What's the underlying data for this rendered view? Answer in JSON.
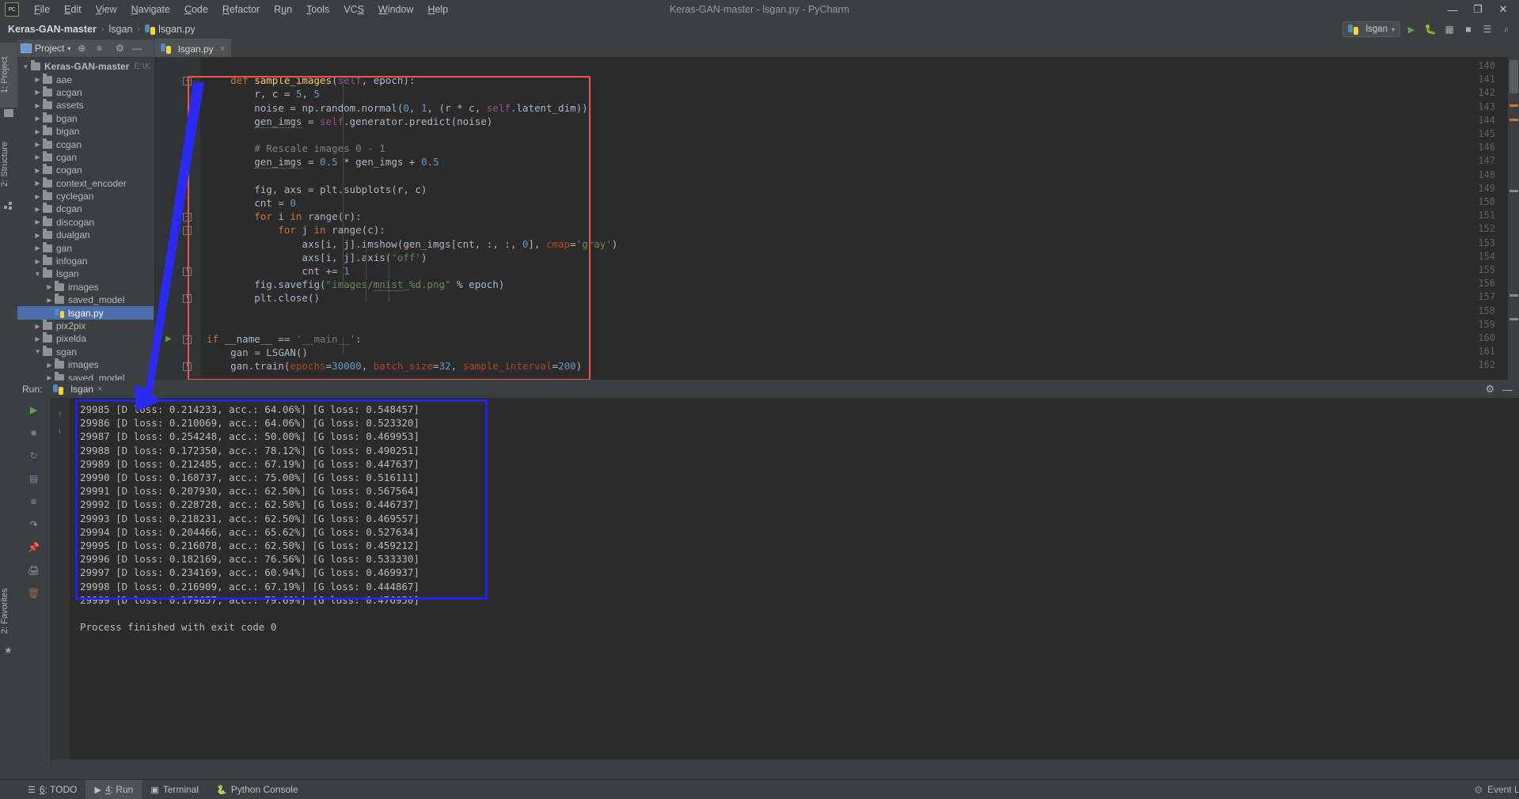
{
  "window": {
    "title": "Keras-GAN-master - lsgan.py - PyCharm",
    "minimize": "—",
    "maximize": "❐",
    "close": "✕"
  },
  "menu": [
    {
      "label": "File",
      "accel": "F"
    },
    {
      "label": "Edit",
      "accel": "E"
    },
    {
      "label": "View",
      "accel": "V"
    },
    {
      "label": "Navigate",
      "accel": "N"
    },
    {
      "label": "Code",
      "accel": "C"
    },
    {
      "label": "Refactor",
      "accel": "R"
    },
    {
      "label": "Run",
      "accel": "u"
    },
    {
      "label": "Tools",
      "accel": "T"
    },
    {
      "label": "VCS",
      "accel": "S"
    },
    {
      "label": "Window",
      "accel": "W"
    },
    {
      "label": "Help",
      "accel": "H"
    }
  ],
  "logo_text": "PC",
  "breadcrumb": {
    "root": "Keras-GAN-master",
    "folder": "lsgan",
    "file": "lsgan.py",
    "separator": "›"
  },
  "navbar_right": {
    "run_config": "lsgan",
    "run_icon": "▶",
    "debug_icon": "ὁe",
    "coverage_icon": "▣",
    "stop_icon": "■",
    "layout_icon": "☰",
    "search_icon": "⌕"
  },
  "left_tool_tabs": [
    {
      "label": "1: Project",
      "accel": "1",
      "active": true
    },
    {
      "label": "2: Structure",
      "accel": "2",
      "active": false
    }
  ],
  "bottom_left_tab": "2: Favorites",
  "project_panel": {
    "title": "Project",
    "dropdown_icon": "▾",
    "locate_icon": "⊕",
    "collapse_icon": "≡",
    "settings_icon": "⚙",
    "hide_icon": "—",
    "root_path": "E:\\K",
    "tree": [
      {
        "label": "Keras-GAN-master",
        "depth": 0,
        "type": "folder",
        "expanded": true,
        "bold": true,
        "selected": false
      },
      {
        "label": "aae",
        "depth": 1,
        "type": "folder",
        "expanded": false,
        "bold": false,
        "selected": false
      },
      {
        "label": "acgan",
        "depth": 1,
        "type": "folder",
        "expanded": false,
        "bold": false,
        "selected": false
      },
      {
        "label": "assets",
        "depth": 1,
        "type": "folder",
        "expanded": false,
        "bold": false,
        "selected": false
      },
      {
        "label": "bgan",
        "depth": 1,
        "type": "folder",
        "expanded": false,
        "bold": false,
        "selected": false
      },
      {
        "label": "bigan",
        "depth": 1,
        "type": "folder",
        "expanded": false,
        "bold": false,
        "selected": false
      },
      {
        "label": "ccgan",
        "depth": 1,
        "type": "folder",
        "expanded": false,
        "bold": false,
        "selected": false
      },
      {
        "label": "cgan",
        "depth": 1,
        "type": "folder",
        "expanded": false,
        "bold": false,
        "selected": false
      },
      {
        "label": "cogan",
        "depth": 1,
        "type": "folder",
        "expanded": false,
        "bold": false,
        "selected": false
      },
      {
        "label": "context_encoder",
        "depth": 1,
        "type": "folder",
        "expanded": false,
        "bold": false,
        "selected": false
      },
      {
        "label": "cyclegan",
        "depth": 1,
        "type": "folder",
        "expanded": false,
        "bold": false,
        "selected": false
      },
      {
        "label": "dcgan",
        "depth": 1,
        "type": "folder",
        "expanded": false,
        "bold": false,
        "selected": false
      },
      {
        "label": "discogan",
        "depth": 1,
        "type": "folder",
        "expanded": false,
        "bold": false,
        "selected": false
      },
      {
        "label": "dualgan",
        "depth": 1,
        "type": "folder",
        "expanded": false,
        "bold": false,
        "selected": false
      },
      {
        "label": "gan",
        "depth": 1,
        "type": "folder",
        "expanded": false,
        "bold": false,
        "selected": false
      },
      {
        "label": "infogan",
        "depth": 1,
        "type": "folder",
        "expanded": false,
        "bold": false,
        "selected": false
      },
      {
        "label": "lsgan",
        "depth": 1,
        "type": "folder",
        "expanded": true,
        "bold": false,
        "selected": false
      },
      {
        "label": "images",
        "depth": 2,
        "type": "folder",
        "expanded": false,
        "bold": false,
        "selected": false
      },
      {
        "label": "saved_model",
        "depth": 2,
        "type": "folder",
        "expanded": false,
        "bold": false,
        "selected": false
      },
      {
        "label": "lsgan.py",
        "depth": 2,
        "type": "python",
        "expanded": null,
        "bold": false,
        "selected": true
      },
      {
        "label": "pix2pix",
        "depth": 1,
        "type": "folder",
        "expanded": false,
        "bold": false,
        "selected": false
      },
      {
        "label": "pixelda",
        "depth": 1,
        "type": "folder",
        "expanded": false,
        "bold": false,
        "selected": false
      },
      {
        "label": "sgan",
        "depth": 1,
        "type": "folder",
        "expanded": true,
        "bold": false,
        "selected": false
      },
      {
        "label": "images",
        "depth": 2,
        "type": "folder",
        "expanded": false,
        "bold": false,
        "selected": false
      },
      {
        "label": "saved_model",
        "depth": 2,
        "type": "folder",
        "expanded": false,
        "bold": false,
        "selected": false
      }
    ]
  },
  "editor": {
    "tab_label": "lsgan.py",
    "close_icon": "×",
    "first_line_number": 140,
    "lines": [
      {
        "n": 140,
        "html": "",
        "fold": null
      },
      {
        "n": 141,
        "html": "    <span class='k'>def</span> <span class='def'>sample_images</span><span class='pl'>(</span><span class='self'>self</span><span class='pl'>, epoch):</span>",
        "fold": "minus"
      },
      {
        "n": 142,
        "html": "        <span class='pl'>r, c = </span><span class='num'>5</span><span class='pl'>, </span><span class='num'>5</span>",
        "fold": null
      },
      {
        "n": 143,
        "html": "        <span class='pl'>noise = np.random.normal(</span><span class='num'>0</span><span class='pl'>, </span><span class='num'>1</span><span class='pl'>, (r * c, </span><span class='self'>self</span><span class='pl'>.latent_dim))</span>",
        "fold": null
      },
      {
        "n": 144,
        "html": "        <span class='pl'><span class='wav'>gen_imgs</span> = </span><span class='self'>self</span><span class='pl'>.generator.predict(noise)</span>",
        "fold": null
      },
      {
        "n": 145,
        "html": "",
        "fold": null
      },
      {
        "n": 146,
        "html": "        <span class='cmt'># Rescale images 0 - 1</span>",
        "fold": null
      },
      {
        "n": 147,
        "html": "        <span class='pl'><span class='wav'>gen_imgs</span> = </span><span class='num'>0.5</span><span class='pl'> * gen_imgs + </span><span class='num'>0.5</span>",
        "fold": null
      },
      {
        "n": 148,
        "html": "",
        "fold": null
      },
      {
        "n": 149,
        "html": "        <span class='pl'>fig, axs = plt.subplots(r, c)</span>",
        "fold": null
      },
      {
        "n": 150,
        "html": "        <span class='pl'>cnt = </span><span class='num'>0</span>",
        "fold": null
      },
      {
        "n": 151,
        "html": "        <span class='k'>for</span><span class='pl'> i </span><span class='k'>in</span><span class='pl'> range(r):</span>",
        "fold": "minus"
      },
      {
        "n": 152,
        "html": "            <span class='k'>for</span><span class='pl'> j </span><span class='k'>in</span><span class='pl'> range(c):</span>",
        "fold": "minus"
      },
      {
        "n": 153,
        "html": "                <span class='pl'>axs[i, j].imshow(gen_imgs[cnt, :, :, </span><span class='num'>0</span><span class='pl'>], </span><span class='kw'>cmap</span><span class='pl'>=</span><span class='str'>'gray'</span><span class='pl'>)</span>",
        "fold": null
      },
      {
        "n": 154,
        "html": "                <span class='pl'>axs[i, j].axis(</span><span class='str'>'off'</span><span class='pl'>)</span>",
        "fold": null
      },
      {
        "n": 155,
        "html": "                <span class='pl'>cnt += </span><span class='num'>1</span>",
        "fold": "end"
      },
      {
        "n": 156,
        "html": "        <span class='pl'>fig.savefig(</span><span class='str'>\"images/<span class='wav'>mnist</span>_%d.png\"</span><span class='pl'> % epoch)</span>",
        "fold": null
      },
      {
        "n": 157,
        "html": "        <span class='pl'>plt.close()</span>",
        "fold": "end"
      },
      {
        "n": 158,
        "html": "",
        "fold": null
      },
      {
        "n": 159,
        "html": "",
        "fold": null
      },
      {
        "n": 160,
        "html": "<span class='k'>if</span><span class='pl'> __name__ == </span><span class='str'>'__main__'</span><span class='pl'>:</span>",
        "fold": "minus",
        "runnable": true
      },
      {
        "n": 161,
        "html": "    <span class='pl'>gan = LSGAN()</span>",
        "fold": null
      },
      {
        "n": 162,
        "html": "    <span class='pl'>gan.train(</span><span class='kw'>epochs</span><span class='pl'>=</span><span class='num'>30000</span><span class='pl'>, </span><span class='kw'>batch_size</span><span class='pl'>=</span><span class='num'>32</span><span class='pl'>, </span><span class='kw'>sample_interval</span><span class='pl'>=</span><span class='num'>200</span><span class='pl'>)</span>",
        "fold": "end"
      }
    ],
    "annotation_red_box": true
  },
  "run_window": {
    "label": "Run:",
    "tab_label": "lsgan",
    "tab_close": "×",
    "settings_icon": "⚙",
    "hide_icon": "—",
    "toolbar_icons": [
      "run-icon",
      "stop-icon",
      "rerun-icon",
      "scroll-up-icon",
      "scroll-down-icon",
      "print-icon",
      "soft-wrap-icon",
      "scroll-end-icon",
      "pin-icon",
      "close-icon",
      "trash-icon"
    ],
    "console_lines": [
      "29985 [D loss: 0.214233, acc.: 64.06%] [G loss: 0.548457]",
      "29986 [D loss: 0.210069, acc.: 64.06%] [G loss: 0.523320]",
      "29987 [D loss: 0.254248, acc.: 50.00%] [G loss: 0.469953]",
      "29988 [D loss: 0.172350, acc.: 78.12%] [G loss: 0.490251]",
      "29989 [D loss: 0.212485, acc.: 67.19%] [G loss: 0.447637]",
      "29990 [D loss: 0.168737, acc.: 75.00%] [G loss: 0.516111]",
      "29991 [D loss: 0.207930, acc.: 62.50%] [G loss: 0.567564]",
      "29992 [D loss: 0.228728, acc.: 62.50%] [G loss: 0.446737]",
      "29993 [D loss: 0.218231, acc.: 62.50%] [G loss: 0.469557]",
      "29994 [D loss: 0.204466, acc.: 65.62%] [G loss: 0.527634]",
      "29995 [D loss: 0.216078, acc.: 62.50%] [G loss: 0.459212]",
      "29996 [D loss: 0.182169, acc.: 76.56%] [G loss: 0.533330]",
      "29997 [D loss: 0.234169, acc.: 60.94%] [G loss: 0.469937]",
      "29998 [D loss: 0.216909, acc.: 67.19%] [G loss: 0.444867]",
      "29999 [D loss: 0.179657, acc.: 79.69%] [G loss: 0.476950]"
    ],
    "exit_message": "Process finished with exit code 0",
    "annotation_blue_box": true
  },
  "status_bar": {
    "items": [
      {
        "label": "6: TODO",
        "accel": "6",
        "icon": "todo-icon",
        "active": false
      },
      {
        "label": "4: Run",
        "accel": "4",
        "icon": "run-icon",
        "active": true
      },
      {
        "label": "Terminal",
        "accel": "",
        "icon": "terminal-icon",
        "active": false
      },
      {
        "label": "Python Console",
        "accel": "",
        "icon": "python-icon",
        "active": false
      }
    ],
    "event_log": "Event Log",
    "event_log_icon": "⊙"
  },
  "colors": {
    "accent_selection": "#4b6eaf",
    "annotation_red": "#f4534f",
    "annotation_blue": "#2222f0",
    "editor_bg": "#2b2b2b",
    "panel_bg": "#3c3f41",
    "gutter_bg": "#313335"
  }
}
